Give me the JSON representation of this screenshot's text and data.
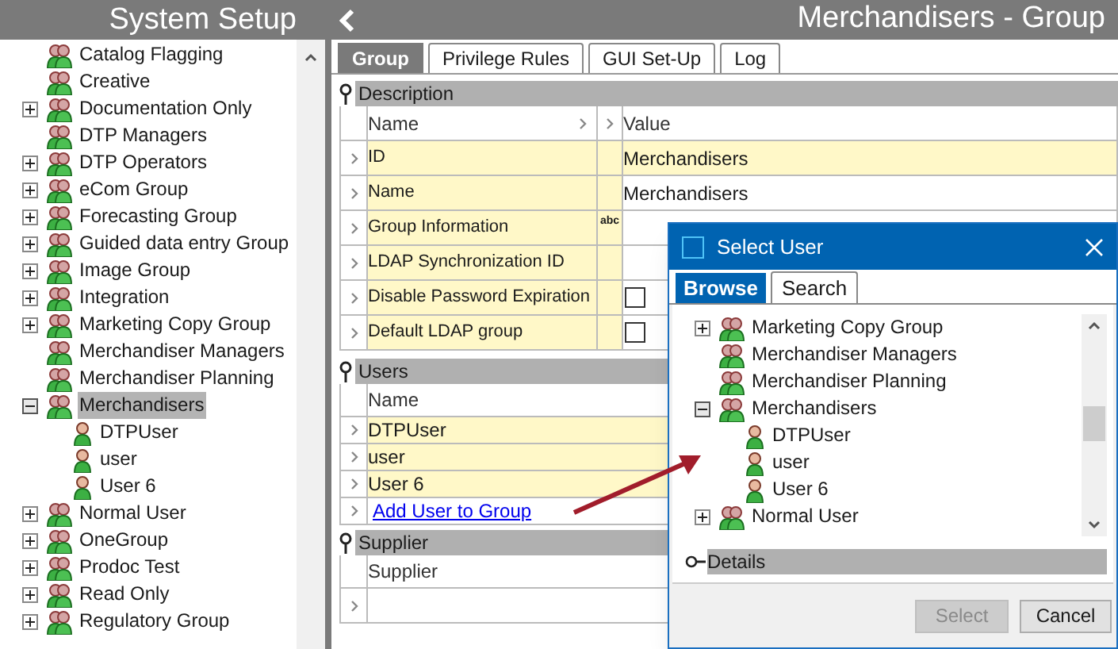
{
  "sidebar": {
    "title": "System Setup",
    "tree": [
      {
        "label": "Catalog Flagging",
        "kind": "group",
        "selected": false
      },
      {
        "label": "Creative",
        "kind": "group",
        "selected": false
      },
      {
        "label": "Documentation Only",
        "kind": "group",
        "expanded": false,
        "selected": false
      },
      {
        "label": "DTP Managers",
        "kind": "group",
        "selected": false
      },
      {
        "label": "DTP Operators",
        "kind": "group",
        "expanded": false,
        "selected": false
      },
      {
        "label": "eCom Group",
        "kind": "group",
        "expanded": false,
        "selected": false
      },
      {
        "label": "Forecasting Group",
        "kind": "group",
        "expanded": false,
        "selected": false
      },
      {
        "label": "Guided data entry Group",
        "kind": "group",
        "expanded": false,
        "selected": false
      },
      {
        "label": "Image Group",
        "kind": "group",
        "expanded": false,
        "selected": false
      },
      {
        "label": "Integration",
        "kind": "group",
        "expanded": false,
        "selected": false
      },
      {
        "label": "Marketing Copy Group",
        "kind": "group",
        "expanded": false,
        "selected": false
      },
      {
        "label": "Merchandiser Managers",
        "kind": "group",
        "selected": false
      },
      {
        "label": "Merchandiser Planning",
        "kind": "group",
        "selected": false
      },
      {
        "label": "Merchandisers",
        "kind": "group",
        "expanded": true,
        "selected": true,
        "children": [
          {
            "label": "DTPUser",
            "kind": "user",
            "selected": false
          },
          {
            "label": "user",
            "kind": "user",
            "selected": false
          },
          {
            "label": "User 6",
            "kind": "user",
            "selected": false
          }
        ]
      },
      {
        "label": "Normal User",
        "kind": "group",
        "expanded": false,
        "selected": false
      },
      {
        "label": "OneGroup",
        "kind": "group",
        "expanded": false,
        "selected": false
      },
      {
        "label": "Prodoc Test",
        "kind": "group",
        "expanded": false,
        "selected": false
      },
      {
        "label": "Read Only",
        "kind": "group",
        "expanded": false,
        "selected": false
      },
      {
        "label": "Regulatory Group",
        "kind": "group",
        "expanded": false,
        "selected": false
      }
    ]
  },
  "main": {
    "title": "Merchandisers - Group",
    "tabs": [
      {
        "label": "Group",
        "selected": true
      },
      {
        "label": "Privilege Rules",
        "selected": false
      },
      {
        "label": "GUI Set-Up",
        "selected": false
      },
      {
        "label": "Log",
        "selected": false
      }
    ],
    "description": {
      "title": "Description",
      "columns": [
        "Name",
        "Value"
      ],
      "rows": [
        {
          "name": "ID",
          "kind": "text",
          "value": "Merchandisers"
        },
        {
          "name": "Name",
          "kind": "text",
          "value": "Merchandisers"
        },
        {
          "name": "Group Information",
          "kind": "text",
          "badge": "abc"
        },
        {
          "name": "LDAP Synchronization ID",
          "kind": "text"
        },
        {
          "name": "Disable Password Expiration",
          "kind": "checkbox",
          "checked": false
        },
        {
          "name": "Default LDAP group",
          "kind": "checkbox",
          "checked": false
        }
      ]
    },
    "users": {
      "title": "Users",
      "column": "Name",
      "rows": [
        "DTPUser",
        "user",
        "User 6"
      ],
      "add_link": "Add User to Group"
    },
    "supplier": {
      "title": "Supplier",
      "column": "Supplier"
    }
  },
  "dialog": {
    "title": "Select User",
    "tabs": [
      {
        "label": "Browse",
        "selected": true
      },
      {
        "label": "Search",
        "selected": false
      }
    ],
    "tree": [
      {
        "label": "Marketing Copy Group",
        "kind": "group",
        "expanded": false
      },
      {
        "label": "Merchandiser Managers",
        "kind": "group"
      },
      {
        "label": "Merchandiser Planning",
        "kind": "group"
      },
      {
        "label": "Merchandisers",
        "kind": "group",
        "expanded": true,
        "children": [
          {
            "label": "DTPUser",
            "kind": "user"
          },
          {
            "label": "user",
            "kind": "user"
          },
          {
            "label": "User 6",
            "kind": "user"
          }
        ]
      },
      {
        "label": "Normal User",
        "kind": "group",
        "expanded": false
      }
    ],
    "details": "Details",
    "buttons": [
      {
        "label": "Select",
        "disabled": true
      },
      {
        "label": "Cancel",
        "disabled": false
      }
    ]
  }
}
